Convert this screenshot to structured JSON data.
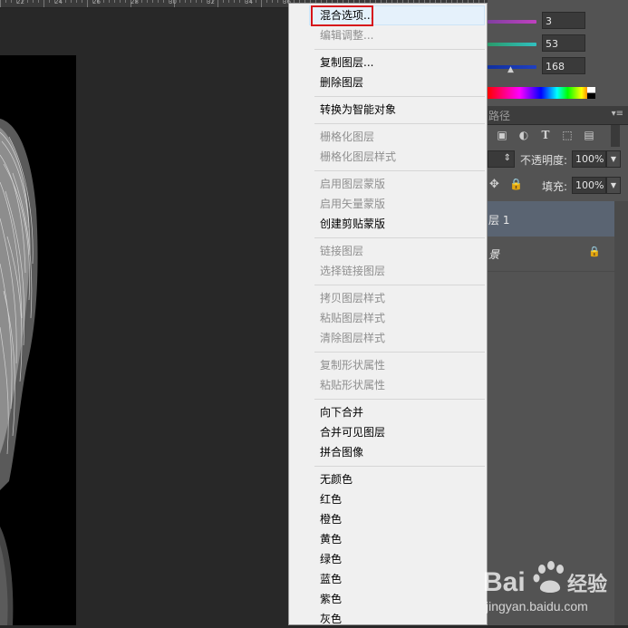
{
  "ruler": {
    "numbers": [
      "22",
      "24",
      "26",
      "28",
      "30",
      "32",
      "34",
      "36"
    ]
  },
  "context_menu": {
    "items": [
      {
        "label": "混合选项...",
        "enabled": true,
        "highlighted": true
      },
      {
        "label": "编辑调整...",
        "enabled": false
      },
      {
        "label": "复制图层...",
        "enabled": true
      },
      {
        "label": "删除图层",
        "enabled": true
      },
      {
        "label": "转换为智能对象",
        "enabled": true
      },
      {
        "label": "栅格化图层",
        "enabled": false
      },
      {
        "label": "栅格化图层样式",
        "enabled": false
      },
      {
        "label": "启用图层蒙版",
        "enabled": false
      },
      {
        "label": "启用矢量蒙版",
        "enabled": false
      },
      {
        "label": "创建剪贴蒙版",
        "enabled": true
      },
      {
        "label": "链接图层",
        "enabled": false
      },
      {
        "label": "选择链接图层",
        "enabled": false
      },
      {
        "label": "拷贝图层样式",
        "enabled": false
      },
      {
        "label": "粘贴图层样式",
        "enabled": false
      },
      {
        "label": "清除图层样式",
        "enabled": false
      },
      {
        "label": "复制形状属性",
        "enabled": false
      },
      {
        "label": "粘贴形状属性",
        "enabled": false
      },
      {
        "label": "向下合并",
        "enabled": true
      },
      {
        "label": "合并可见图层",
        "enabled": true
      },
      {
        "label": "拼合图像",
        "enabled": true
      },
      {
        "label": "无颜色",
        "enabled": true
      },
      {
        "label": "红色",
        "enabled": true
      },
      {
        "label": "橙色",
        "enabled": true
      },
      {
        "label": "黄色",
        "enabled": true
      },
      {
        "label": "绿色",
        "enabled": true
      },
      {
        "label": "蓝色",
        "enabled": true
      },
      {
        "label": "紫色",
        "enabled": true
      },
      {
        "label": "灰色",
        "enabled": true
      }
    ]
  },
  "color_panel": {
    "values": [
      "3",
      "53",
      "168"
    ],
    "track_colors": [
      "#c040c0",
      "#30c0c0",
      "#2040c0"
    ]
  },
  "layers_panel": {
    "tab_label": "路径",
    "opacity_label": "不透明度:",
    "opacity_value": "100%",
    "fill_label": "填充:",
    "fill_value": "100%",
    "layer_1_name": "层 1",
    "background_layer_name": "景"
  },
  "watermark": {
    "brand": "Bai",
    "brand_suffix": "经验",
    "url": "jingyan.baidu.com"
  },
  "colors": {
    "menu_bg": "#f0f0f0",
    "highlight": "#e5f1fb",
    "red_outline": "#d6141b",
    "panel": "#535353",
    "selected_layer": "#5a6472"
  }
}
